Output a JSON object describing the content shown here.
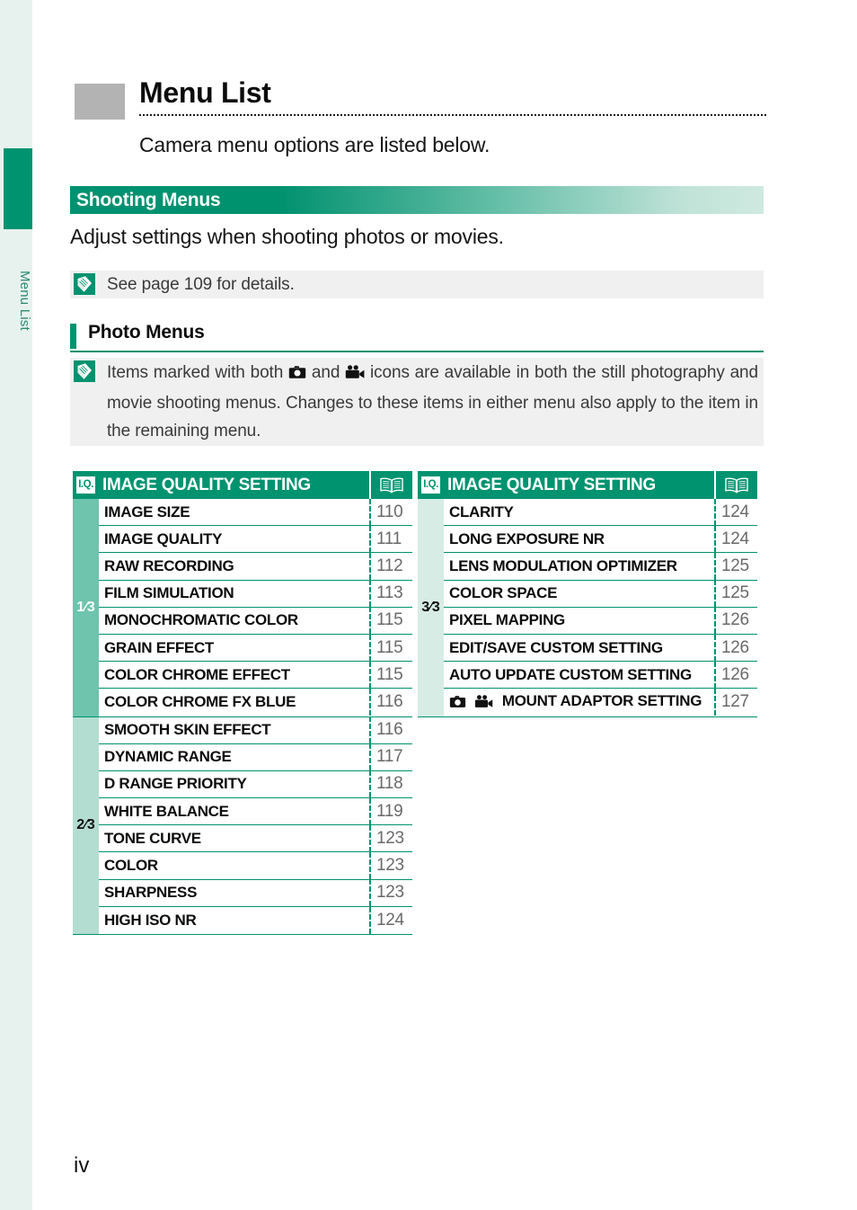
{
  "sidebar": {
    "label": "Menu List",
    "tab_color": "#00936f",
    "bg_color": "#e7f2ee"
  },
  "header": {
    "title": "Menu List",
    "subtitle": "Camera menu options are listed below."
  },
  "section": {
    "band_label": "Shooting Menus",
    "description": "Adjust settings when shooting photos or movies.",
    "note": "See page 109 for details."
  },
  "subsection": {
    "label": "Photo Menus",
    "note_prefix": "Items marked with both",
    "note_mid": "and",
    "note_suffix": "icons are available in both the still photography and movie shooting menus. Changes to these items in either menu also apply to the item in the remaining menu."
  },
  "icons": {
    "note": "note-icon",
    "book": "book-icon",
    "iq_badge": "I.Q.",
    "still_camera": "still-camera-icon",
    "movie_camera": "movie-camera-icon"
  },
  "colors": {
    "brand_green": "#00936f",
    "tab_1": "#6ec4ad",
    "tab_2": "#b4ddd1",
    "tab_3": "#d6ece4",
    "note_bg": "#f0f0f0",
    "page_number_gray": "#6a6a6a"
  },
  "tables": [
    {
      "id": "left",
      "header_badge": "I.Q.",
      "header_title": "IMAGE QUALITY SETTING",
      "groups": [
        {
          "tab": "1⁄3",
          "rows": [
            {
              "label": "IMAGE SIZE",
              "page": "110"
            },
            {
              "label": "IMAGE QUALITY",
              "page": "111"
            },
            {
              "label": "RAW RECORDING",
              "page": "112"
            },
            {
              "label": "FILM SIMULATION",
              "page": "113"
            },
            {
              "label": "MONOCHROMATIC COLOR",
              "page": "115"
            },
            {
              "label": "GRAIN EFFECT",
              "page": "115"
            },
            {
              "label": "COLOR CHROME EFFECT",
              "page": "115"
            },
            {
              "label": "COLOR CHROME FX BLUE",
              "page": "116"
            }
          ]
        },
        {
          "tab": "2⁄3",
          "rows": [
            {
              "label": "SMOOTH SKIN EFFECT",
              "page": "116"
            },
            {
              "label": "DYNAMIC RANGE",
              "page": "117"
            },
            {
              "label": "D RANGE PRIORITY",
              "page": "118"
            },
            {
              "label": "WHITE BALANCE",
              "page": "119"
            },
            {
              "label": "TONE CURVE",
              "page": "123"
            },
            {
              "label": "COLOR",
              "page": "123"
            },
            {
              "label": "SHARPNESS",
              "page": "123"
            },
            {
              "label": "HIGH ISO NR",
              "page": "124"
            }
          ]
        }
      ]
    },
    {
      "id": "right",
      "header_badge": "I.Q.",
      "header_title": "IMAGE QUALITY SETTING",
      "groups": [
        {
          "tab": "3⁄3",
          "rows": [
            {
              "label": "CLARITY",
              "page": "124"
            },
            {
              "label": "LONG EXPOSURE NR",
              "page": "124"
            },
            {
              "label": "LENS MODULATION OPTIMIZER",
              "page": "125"
            },
            {
              "label": "COLOR SPACE",
              "page": "125"
            },
            {
              "label": "PIXEL MAPPING",
              "page": "126"
            },
            {
              "label": "EDIT/SAVE CUSTOM SETTING",
              "page": "126"
            },
            {
              "label": "AUTO UPDATE CUSTOM SETTING",
              "page": "126"
            },
            {
              "label": "MOUNT ADAPTOR SETTING",
              "page": "127",
              "icons": true
            }
          ]
        }
      ]
    }
  ],
  "footer": {
    "folio": "iv"
  }
}
